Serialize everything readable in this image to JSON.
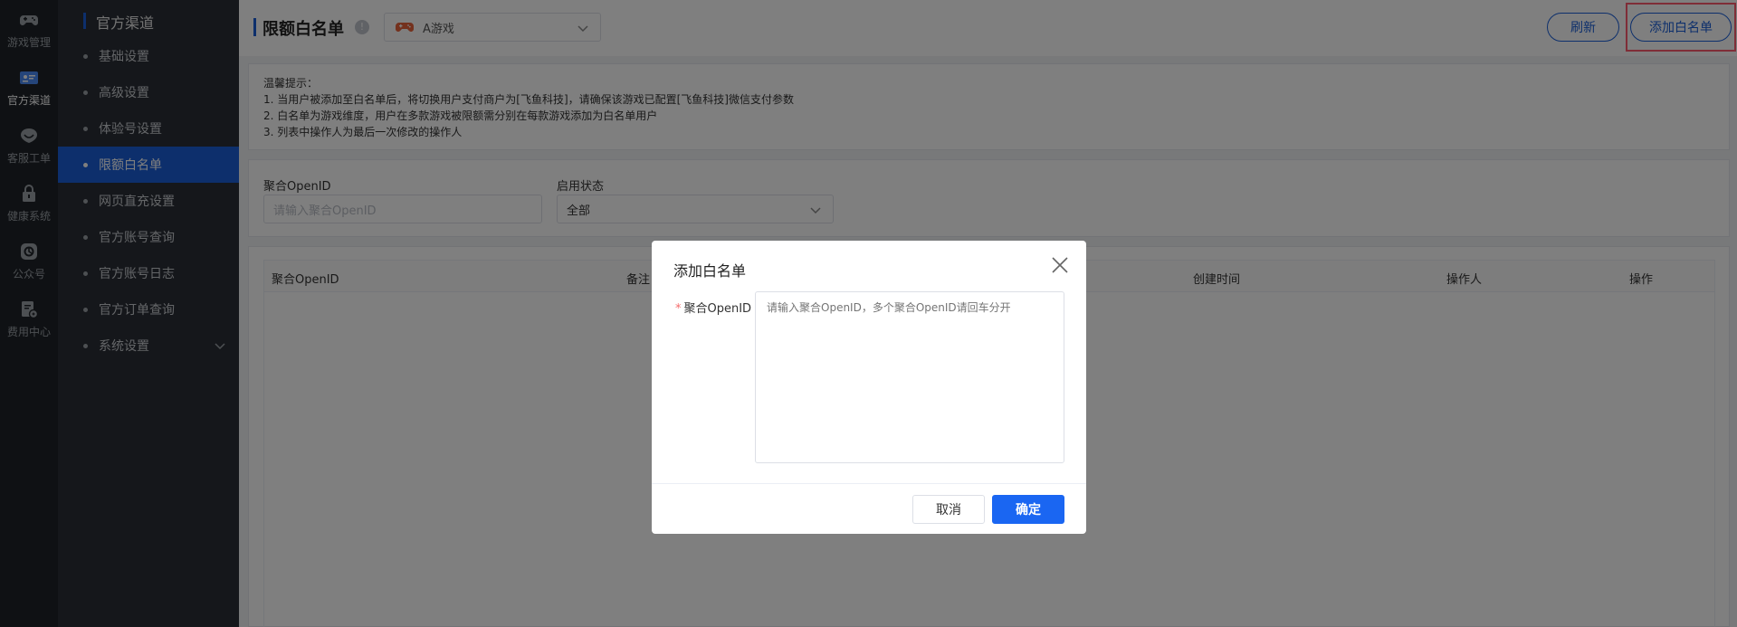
{
  "rail": {
    "items": [
      {
        "label": "游戏管理",
        "icon": "gamepad-icon"
      },
      {
        "label": "官方渠道",
        "icon": "id-card-icon"
      },
      {
        "label": "客服工单",
        "icon": "service-icon"
      },
      {
        "label": "健康系统",
        "icon": "lock-icon"
      },
      {
        "label": "公众号",
        "icon": "official-account-icon"
      },
      {
        "label": "费用中心",
        "icon": "billing-icon"
      }
    ]
  },
  "menu": {
    "title": "官方渠道",
    "items": [
      {
        "label": "基础设置"
      },
      {
        "label": "高级设置"
      },
      {
        "label": "体验号设置"
      },
      {
        "label": "限额白名单"
      },
      {
        "label": "网页直充设置"
      },
      {
        "label": "官方账号查询"
      },
      {
        "label": "官方账号日志"
      },
      {
        "label": "官方订单查询"
      },
      {
        "label": "系统设置"
      }
    ]
  },
  "header": {
    "title": "限额白名单",
    "game_select_value": "A游戏",
    "refresh_label": "刷新",
    "add_label": "添加白名单"
  },
  "notice": {
    "lines": [
      "温馨提示：",
      "1. 当用户被添加至白名单后，将切换用户支付商户为[飞鱼科技]，请确保该游戏已配置[飞鱼科技]微信支付参数",
      "2. 白名单为游戏维度，用户在多款游戏被限额需分别在每款游戏添加为白名单用户",
      "3. 列表中操作人为最后一次修改的操作人"
    ]
  },
  "filters": {
    "openid_label": "聚合OpenID",
    "openid_placeholder": "请输入聚合OpenID",
    "status_label": "启用状态",
    "status_value": "全部"
  },
  "table": {
    "columns": [
      "聚合OpenID",
      "备注",
      "创建时间",
      "操作人",
      "操作"
    ]
  },
  "modal": {
    "title": "添加白名单",
    "field_label": "聚合OpenID",
    "textarea_placeholder": "请输入聚合OpenID，多个聚合OpenID请回车分开",
    "cancel_label": "取消",
    "ok_label": "确定"
  },
  "colors": {
    "accent": "#1a5fd8",
    "primary_button": "#1a66f2",
    "highlight": "#ff5a6e",
    "rail_bg": "#1f2328",
    "menu_bg": "#2b2f36"
  }
}
